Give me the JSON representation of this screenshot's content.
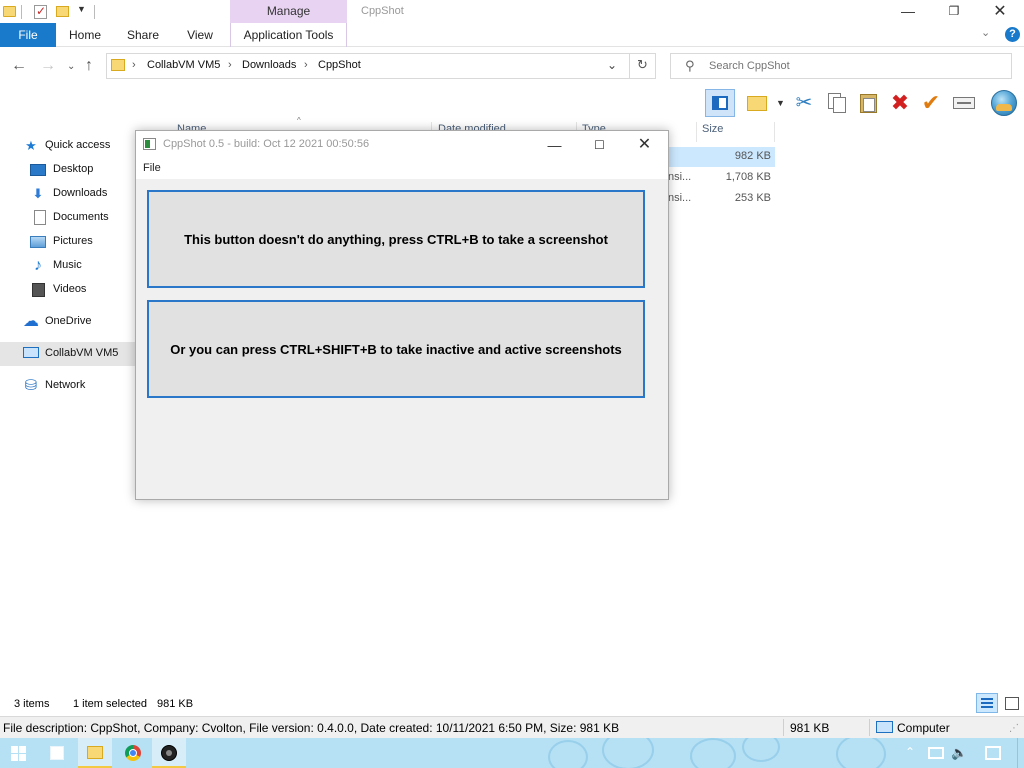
{
  "titlebar": {
    "manage_label": "Manage",
    "window_title": "CppShot",
    "minimize": "—",
    "maximize": "❐",
    "close": "✕"
  },
  "ribbon": {
    "tabs": {
      "file": "File",
      "home": "Home",
      "share": "Share",
      "view": "View",
      "application_tools": "Application Tools"
    },
    "expand_glyph": "⌄",
    "help_glyph": "?"
  },
  "address": {
    "crumbs": [
      "CollabVM VM5",
      "Downloads",
      "CppShot"
    ],
    "separator": "›",
    "dropdown_glyph": "⌄",
    "refresh_glyph": "↻"
  },
  "search": {
    "placeholder": "Search CppShot",
    "icon": "search-icon"
  },
  "nav": {
    "back": "←",
    "forward": "→",
    "recent": "⌄",
    "up": "↑"
  },
  "toolbar": {
    "dropdown_glyph": "▼",
    "cut_glyph": "✂",
    "delete_glyph": "✖",
    "rename_glyph": "✔"
  },
  "sidebar": {
    "items": [
      {
        "label": "Quick access",
        "icon": "star-icon",
        "glyph": "★"
      },
      {
        "label": "Desktop",
        "icon": "desktop-icon",
        "glyph": ""
      },
      {
        "label": "Downloads",
        "icon": "download-icon",
        "glyph": "⬇"
      },
      {
        "label": "Documents",
        "icon": "document-icon",
        "glyph": ""
      },
      {
        "label": "Pictures",
        "icon": "pictures-icon",
        "glyph": ""
      },
      {
        "label": "Music",
        "icon": "music-icon",
        "glyph": "♪"
      },
      {
        "label": "Videos",
        "icon": "video-icon",
        "glyph": ""
      },
      {
        "label": "OneDrive",
        "icon": "cloud-icon",
        "glyph": "☁"
      },
      {
        "label": "CollabVM VM5",
        "icon": "computer-icon",
        "glyph": ""
      },
      {
        "label": "Network",
        "icon": "network-icon",
        "glyph": "⛁"
      }
    ]
  },
  "filelist": {
    "columns": {
      "name": "Name",
      "date_modified": "Date modified",
      "type": "Type",
      "size": "Size"
    },
    "sort_glyph": "^",
    "rows": [
      {
        "type": "",
        "size": "982 KB"
      },
      {
        "type": "nsi...",
        "size": "1,708 KB"
      },
      {
        "type": "nsi...",
        "size": "253 KB"
      }
    ]
  },
  "status": {
    "items": "3 items",
    "selected": "1 item selected",
    "selected_size": "981 KB"
  },
  "description": {
    "text": "File description: CppShot, Company: Cvolton, File version: 0.4.0.0, Date created: 10/11/2021 6:50 PM, Size: 981 KB",
    "size": "981 KB",
    "computer": "Computer",
    "grip": "⋰"
  },
  "taskbar": {
    "apps": [
      "store-icon",
      "file-explorer-icon",
      "chrome-icon",
      "cppshot-icon"
    ],
    "tray_chevron": "⌃",
    "volume_glyph": "🔈"
  },
  "cppshot": {
    "title": "CppShot 0.5 - build: Oct 12 2021 00:50:56",
    "minimize": "—",
    "maximize": "☐",
    "close": "✕",
    "menu_file": "File",
    "button1": "This button doesn't do anything, press CTRL+B to take a screenshot",
    "button2": "Or you can press CTRL+SHIFT+B to take inactive and active screenshots"
  },
  "colors": {
    "accent": "#1979ca",
    "manage_tab": "#e8d3f3",
    "selection": "#cce8ff",
    "button_border": "#2a77c9",
    "taskbar": "#b6e0f4"
  }
}
